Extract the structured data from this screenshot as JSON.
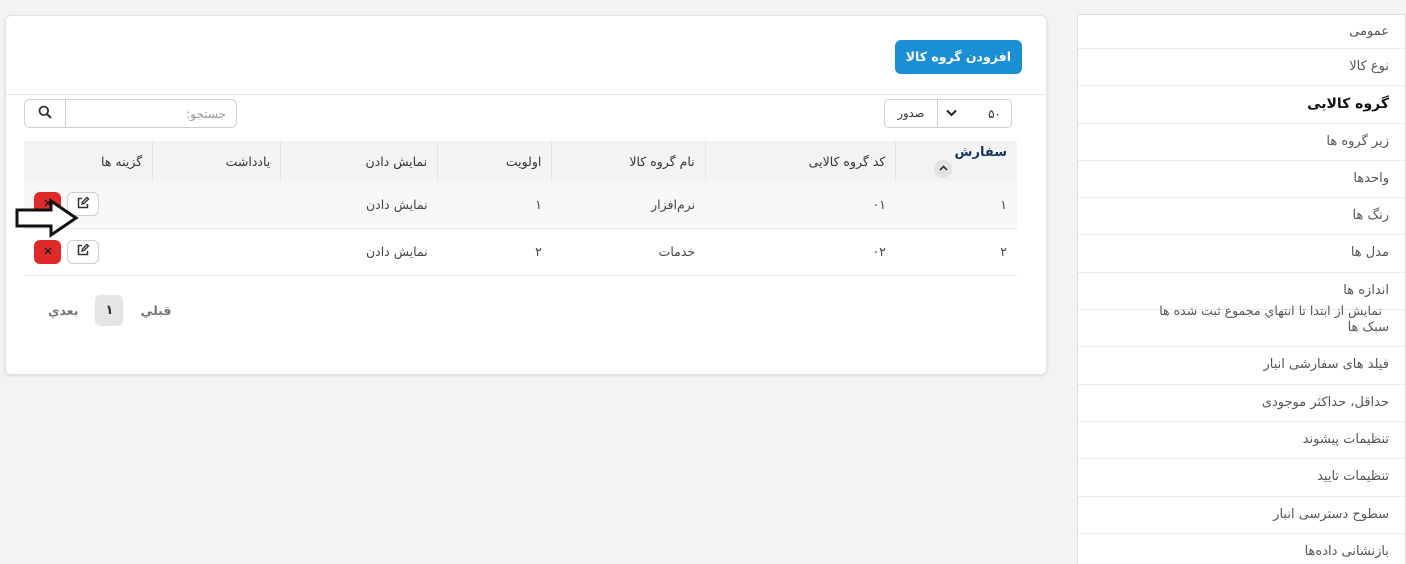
{
  "sidebar": {
    "items": [
      {
        "label": "عمومی"
      },
      {
        "label": "نوع کالا"
      },
      {
        "label": "گروه کالایی"
      },
      {
        "label": "زیر گروه ها"
      },
      {
        "label": "واحدها"
      },
      {
        "label": "رنگ ها"
      },
      {
        "label": "مدل ها"
      },
      {
        "label": "اندازه ها"
      },
      {
        "label": "سبک ها"
      },
      {
        "label": "فیلد های سفارشی انبار"
      },
      {
        "label": "حداقل، حداکثر موجودی"
      },
      {
        "label": "تنظیمات پیشوند"
      },
      {
        "label": "تنظیمات تایید"
      },
      {
        "label": "سطوح دسترسی انبار"
      },
      {
        "label": "بازنشانی دادەها"
      }
    ],
    "active_index": 2
  },
  "header": {
    "add_button_label": "افزودن گروه کالا"
  },
  "controls": {
    "page_length_value": "۵۰",
    "export_label": "صدور",
    "search_placeholder": "جستجو:"
  },
  "table": {
    "columns": [
      "سفارش",
      "کد گروه کالایی",
      "نام گروه کالا",
      "اولویت",
      "نمایش دادن",
      "یادداشت",
      "گزینه ها"
    ],
    "rows": [
      {
        "order": "۱",
        "code": "۰۱",
        "name": "نرم‌افزار",
        "priority": "۱",
        "display": "نمایش دادن",
        "note": ""
      },
      {
        "order": "۲",
        "code": "۰۲",
        "name": "خدمات",
        "priority": "۲",
        "display": "نمایش دادن",
        "note": ""
      }
    ]
  },
  "footer": {
    "info": "نمایش از ابتدا تا انتهاي مجموع ثبت شده ها",
    "prev_label": "قبلي",
    "current_page": "۱",
    "next_label": "بعدي"
  },
  "colors": {
    "accent": "#1b8fd3",
    "danger": "#e02a2a"
  },
  "icons": [
    "search-icon",
    "edit-icon",
    "close-icon",
    "chevron-down-icon",
    "sort-up-icon",
    "arrow-right-icon"
  ]
}
